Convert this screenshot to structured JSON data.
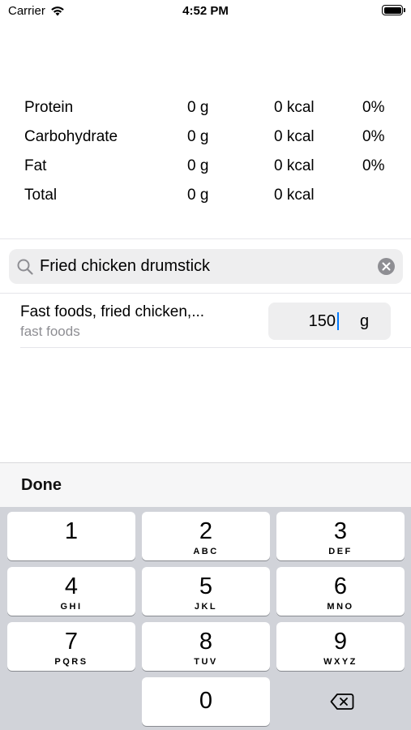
{
  "status_bar": {
    "carrier": "Carrier",
    "time": "4:52 PM"
  },
  "nutrition": {
    "rows": [
      {
        "label": "Protein",
        "grams": "0 g",
        "kcal": "0 kcal",
        "percent": "0%"
      },
      {
        "label": "Carbohydrate",
        "grams": "0 g",
        "kcal": "0 kcal",
        "percent": "0%"
      },
      {
        "label": "Fat",
        "grams": "0 g",
        "kcal": "0 kcal",
        "percent": "0%"
      },
      {
        "label": "Total",
        "grams": "0 g",
        "kcal": "0 kcal",
        "percent": ""
      }
    ]
  },
  "search": {
    "value": "Fried chicken drumstick"
  },
  "result": {
    "title": "Fast foods, fried chicken,...",
    "category": "fast foods",
    "quantity": "150",
    "unit": "g"
  },
  "toolbar": {
    "done_label": "Done"
  },
  "keypad": {
    "keys": [
      {
        "num": "1",
        "letters": ""
      },
      {
        "num": "2",
        "letters": "ABC"
      },
      {
        "num": "3",
        "letters": "DEF"
      },
      {
        "num": "4",
        "letters": "GHI"
      },
      {
        "num": "5",
        "letters": "JKL"
      },
      {
        "num": "6",
        "letters": "MNO"
      },
      {
        "num": "7",
        "letters": "PQRS"
      },
      {
        "num": "8",
        "letters": "TUV"
      },
      {
        "num": "9",
        "letters": "WXYZ"
      },
      {
        "num": "0",
        "letters": ""
      }
    ]
  }
}
